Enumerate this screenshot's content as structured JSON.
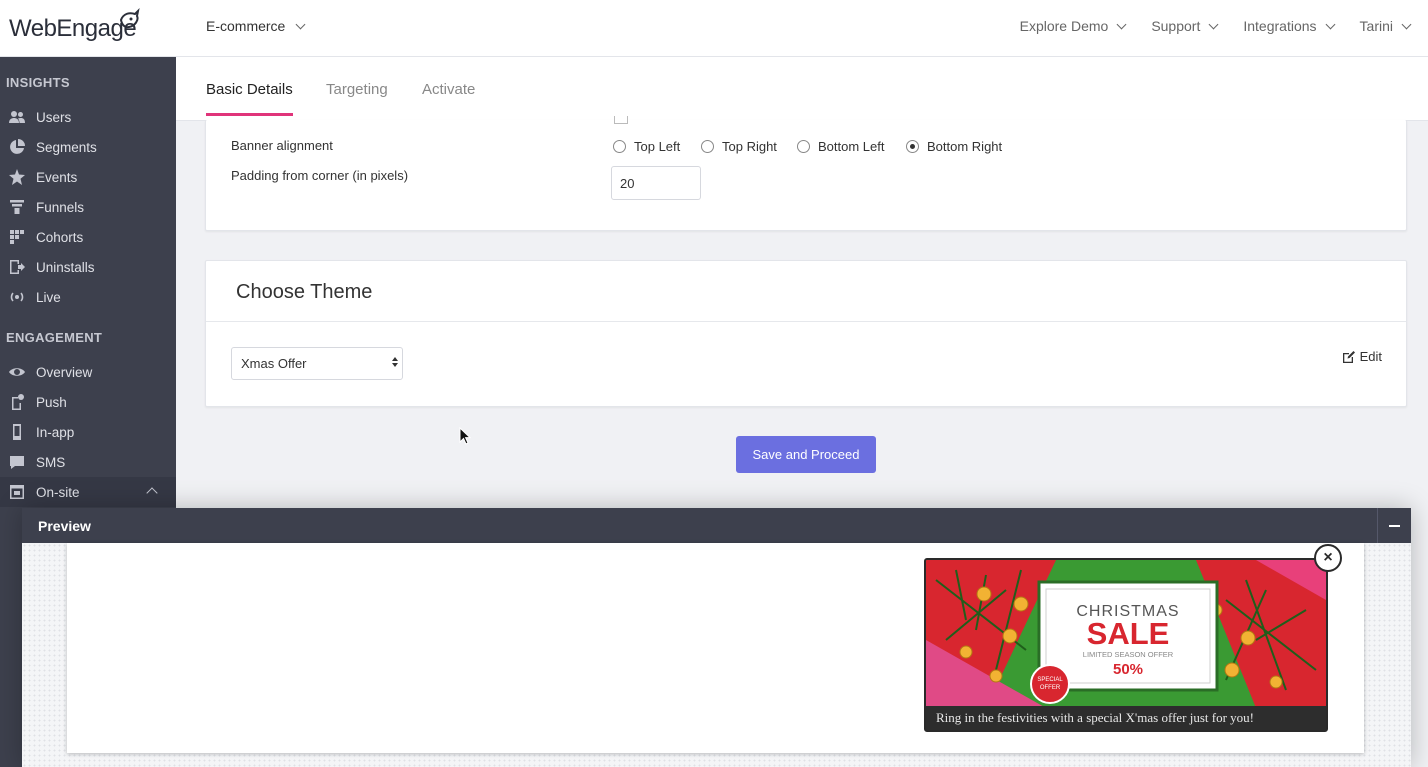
{
  "brand": {
    "logo_text": "WebEngage"
  },
  "header": {
    "project": "E-commerce",
    "nav": [
      "Explore Demo",
      "Support",
      "Integrations",
      "Tarini"
    ]
  },
  "sidebar": {
    "insights_title": "INSIGHTS",
    "insights": [
      {
        "label": "Users",
        "icon": "users-icon"
      },
      {
        "label": "Segments",
        "icon": "pie-icon"
      },
      {
        "label": "Events",
        "icon": "star-icon"
      },
      {
        "label": "Funnels",
        "icon": "funnel-icon"
      },
      {
        "label": "Cohorts",
        "icon": "grid-icon"
      },
      {
        "label": "Uninstalls",
        "icon": "exit-icon"
      },
      {
        "label": "Live",
        "icon": "broadcast-icon"
      }
    ],
    "engagement_title": "ENGAGEMENT",
    "engagement": [
      {
        "label": "Overview",
        "icon": "eye-icon"
      },
      {
        "label": "Push",
        "icon": "push-icon"
      },
      {
        "label": "In-app",
        "icon": "mobile-icon"
      },
      {
        "label": "SMS",
        "icon": "chat-icon"
      },
      {
        "label": "On-site",
        "icon": "window-icon"
      }
    ]
  },
  "tabs": [
    "Basic Details",
    "Targeting",
    "Activate"
  ],
  "placement": {
    "alignment_label": "Banner alignment",
    "alignment_options": [
      "Top Left",
      "Top Right",
      "Bottom Left",
      "Bottom Right"
    ],
    "alignment_selected": "Bottom Right",
    "padding_label": "Padding from corner (in pixels)",
    "padding_value": "20"
  },
  "theme": {
    "title": "Choose Theme",
    "selected": "Xmas Offer",
    "edit_label": "Edit"
  },
  "actions": {
    "save_label": "Save and Proceed"
  },
  "preview": {
    "title": "Preview",
    "banner": {
      "line1": "CHRISTMAS",
      "line2": "SALE",
      "line3": "LIMITED SEASON OFFER",
      "line4": "50%",
      "badge_top": "SPECIAL",
      "badge_bottom": "OFFER",
      "caption": "Ring in the festivities with a special X'mas offer just for you!"
    }
  },
  "colors": {
    "accent": "#e0347a",
    "primary_button": "#6b6fe0",
    "sidebar": "#3d404d"
  }
}
